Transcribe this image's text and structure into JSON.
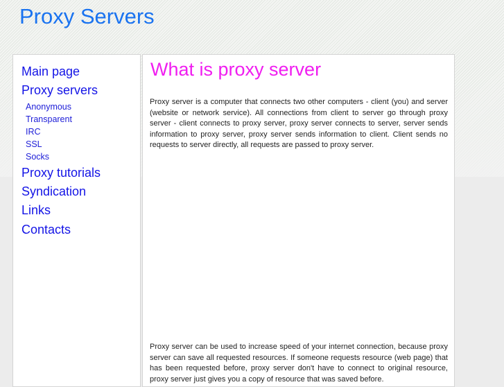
{
  "header": {
    "site_title": "Proxy Servers"
  },
  "sidebar": {
    "items": [
      {
        "label": "Main page"
      },
      {
        "label": "Proxy servers",
        "subitems": [
          {
            "label": "Anonymous"
          },
          {
            "label": "Transparent"
          },
          {
            "label": "IRC"
          },
          {
            "label": "SSL"
          },
          {
            "label": "Socks"
          }
        ]
      },
      {
        "label": "Proxy tutorials"
      },
      {
        "label": "Syndication"
      },
      {
        "label": "Links"
      },
      {
        "label": "Contacts"
      }
    ]
  },
  "main": {
    "title": "What is proxy server",
    "paragraphs": [
      "Proxy server is a computer that connects two other computers - client (you) and server (website or network service). All connections from client to server go through proxy server - client connects to proxy server, proxy server connects to server, server sends information to proxy server, proxy server sends information to client. Client sends no requests to server directly, all requests are passed to proxy server.",
      "Proxy server can be used to increase speed of your internet connection, because proxy server can save all requested resources. If someone requests resource (web page) that has been requested before, proxy server don't have to connect to original resource, proxy server just gives you a copy of resource that was saved before."
    ]
  },
  "colors": {
    "site_title": "#1a73f0",
    "nav_link": "#1414e6",
    "content_title": "#f01ef0",
    "body_text": "#222222"
  }
}
